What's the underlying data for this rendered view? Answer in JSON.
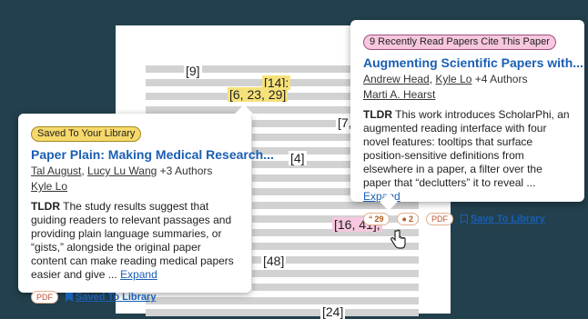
{
  "paper": {
    "citations": [
      "[9]",
      "[14];",
      "[6, 23, 29]",
      "[7,",
      "[4]",
      "[16, 41];",
      "[48]",
      "[24]"
    ]
  },
  "left_card": {
    "badge": "Saved To Your Library",
    "title": "Paper Plain: Making Medical Research...",
    "authors": [
      "Tal August",
      "Lucy Lu Wang",
      "+3 Authors",
      "Kyle Lo"
    ],
    "tldr_label": "TLDR",
    "tldr_text": "The study results suggest that guiding readers to relevant passages and providing plain language summaries, or “gists,” alongside the original paper content can make reading medical papers easier and give ...",
    "expand": "Expand",
    "pdf_label": "PDF",
    "saved_label": "Saved To Library"
  },
  "right_card": {
    "badge": "9 Recently Read Papers Cite This Paper",
    "title": "Augmenting Scientific Papers with...",
    "authors": [
      "Andrew Head",
      "Kyle Lo",
      "+4 Authors",
      "Marti A. Hearst"
    ],
    "tldr_label": "TLDR",
    "tldr_text": "This work introduces ScholarPhi, an augmented reading interface with four novel features: tooltips that surface position-sensitive definitions from elsewhere in a paper, a filter over the paper that “declutters” it to reveal ...",
    "expand": "Expand",
    "citation_count": "29",
    "influential_count": "2",
    "pdf_label": "PDF",
    "save_label": "Save To Library"
  },
  "colors": {
    "background": "#22404d",
    "accent_link": "#1a5fb4",
    "highlight_yellow": "#f6e27a",
    "highlight_pink": "#f6c7de"
  },
  "icons": [
    "quote-icon",
    "influential-icon",
    "bookmark-icon",
    "cursor-hand-icon"
  ]
}
